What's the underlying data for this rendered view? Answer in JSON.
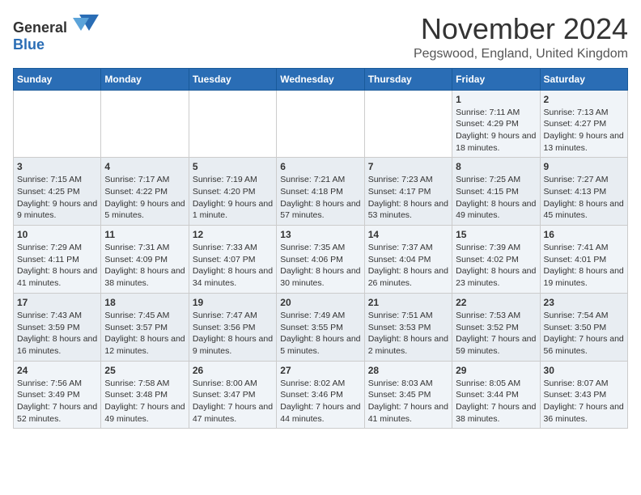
{
  "header": {
    "logo_general": "General",
    "logo_blue": "Blue",
    "month_title": "November 2024",
    "location": "Pegswood, England, United Kingdom"
  },
  "weekdays": [
    "Sunday",
    "Monday",
    "Tuesday",
    "Wednesday",
    "Thursday",
    "Friday",
    "Saturday"
  ],
  "weeks": [
    [
      {
        "day": "",
        "info": ""
      },
      {
        "day": "",
        "info": ""
      },
      {
        "day": "",
        "info": ""
      },
      {
        "day": "",
        "info": ""
      },
      {
        "day": "",
        "info": ""
      },
      {
        "day": "1",
        "info": "Sunrise: 7:11 AM\nSunset: 4:29 PM\nDaylight: 9 hours and 18 minutes."
      },
      {
        "day": "2",
        "info": "Sunrise: 7:13 AM\nSunset: 4:27 PM\nDaylight: 9 hours and 13 minutes."
      }
    ],
    [
      {
        "day": "3",
        "info": "Sunrise: 7:15 AM\nSunset: 4:25 PM\nDaylight: 9 hours and 9 minutes."
      },
      {
        "day": "4",
        "info": "Sunrise: 7:17 AM\nSunset: 4:22 PM\nDaylight: 9 hours and 5 minutes."
      },
      {
        "day": "5",
        "info": "Sunrise: 7:19 AM\nSunset: 4:20 PM\nDaylight: 9 hours and 1 minute."
      },
      {
        "day": "6",
        "info": "Sunrise: 7:21 AM\nSunset: 4:18 PM\nDaylight: 8 hours and 57 minutes."
      },
      {
        "day": "7",
        "info": "Sunrise: 7:23 AM\nSunset: 4:17 PM\nDaylight: 8 hours and 53 minutes."
      },
      {
        "day": "8",
        "info": "Sunrise: 7:25 AM\nSunset: 4:15 PM\nDaylight: 8 hours and 49 minutes."
      },
      {
        "day": "9",
        "info": "Sunrise: 7:27 AM\nSunset: 4:13 PM\nDaylight: 8 hours and 45 minutes."
      }
    ],
    [
      {
        "day": "10",
        "info": "Sunrise: 7:29 AM\nSunset: 4:11 PM\nDaylight: 8 hours and 41 minutes."
      },
      {
        "day": "11",
        "info": "Sunrise: 7:31 AM\nSunset: 4:09 PM\nDaylight: 8 hours and 38 minutes."
      },
      {
        "day": "12",
        "info": "Sunrise: 7:33 AM\nSunset: 4:07 PM\nDaylight: 8 hours and 34 minutes."
      },
      {
        "day": "13",
        "info": "Sunrise: 7:35 AM\nSunset: 4:06 PM\nDaylight: 8 hours and 30 minutes."
      },
      {
        "day": "14",
        "info": "Sunrise: 7:37 AM\nSunset: 4:04 PM\nDaylight: 8 hours and 26 minutes."
      },
      {
        "day": "15",
        "info": "Sunrise: 7:39 AM\nSunset: 4:02 PM\nDaylight: 8 hours and 23 minutes."
      },
      {
        "day": "16",
        "info": "Sunrise: 7:41 AM\nSunset: 4:01 PM\nDaylight: 8 hours and 19 minutes."
      }
    ],
    [
      {
        "day": "17",
        "info": "Sunrise: 7:43 AM\nSunset: 3:59 PM\nDaylight: 8 hours and 16 minutes."
      },
      {
        "day": "18",
        "info": "Sunrise: 7:45 AM\nSunset: 3:57 PM\nDaylight: 8 hours and 12 minutes."
      },
      {
        "day": "19",
        "info": "Sunrise: 7:47 AM\nSunset: 3:56 PM\nDaylight: 8 hours and 9 minutes."
      },
      {
        "day": "20",
        "info": "Sunrise: 7:49 AM\nSunset: 3:55 PM\nDaylight: 8 hours and 5 minutes."
      },
      {
        "day": "21",
        "info": "Sunrise: 7:51 AM\nSunset: 3:53 PM\nDaylight: 8 hours and 2 minutes."
      },
      {
        "day": "22",
        "info": "Sunrise: 7:53 AM\nSunset: 3:52 PM\nDaylight: 7 hours and 59 minutes."
      },
      {
        "day": "23",
        "info": "Sunrise: 7:54 AM\nSunset: 3:50 PM\nDaylight: 7 hours and 56 minutes."
      }
    ],
    [
      {
        "day": "24",
        "info": "Sunrise: 7:56 AM\nSunset: 3:49 PM\nDaylight: 7 hours and 52 minutes."
      },
      {
        "day": "25",
        "info": "Sunrise: 7:58 AM\nSunset: 3:48 PM\nDaylight: 7 hours and 49 minutes."
      },
      {
        "day": "26",
        "info": "Sunrise: 8:00 AM\nSunset: 3:47 PM\nDaylight: 7 hours and 47 minutes."
      },
      {
        "day": "27",
        "info": "Sunrise: 8:02 AM\nSunset: 3:46 PM\nDaylight: 7 hours and 44 minutes."
      },
      {
        "day": "28",
        "info": "Sunrise: 8:03 AM\nSunset: 3:45 PM\nDaylight: 7 hours and 41 minutes."
      },
      {
        "day": "29",
        "info": "Sunrise: 8:05 AM\nSunset: 3:44 PM\nDaylight: 7 hours and 38 minutes."
      },
      {
        "day": "30",
        "info": "Sunrise: 8:07 AM\nSunset: 3:43 PM\nDaylight: 7 hours and 36 minutes."
      }
    ]
  ]
}
